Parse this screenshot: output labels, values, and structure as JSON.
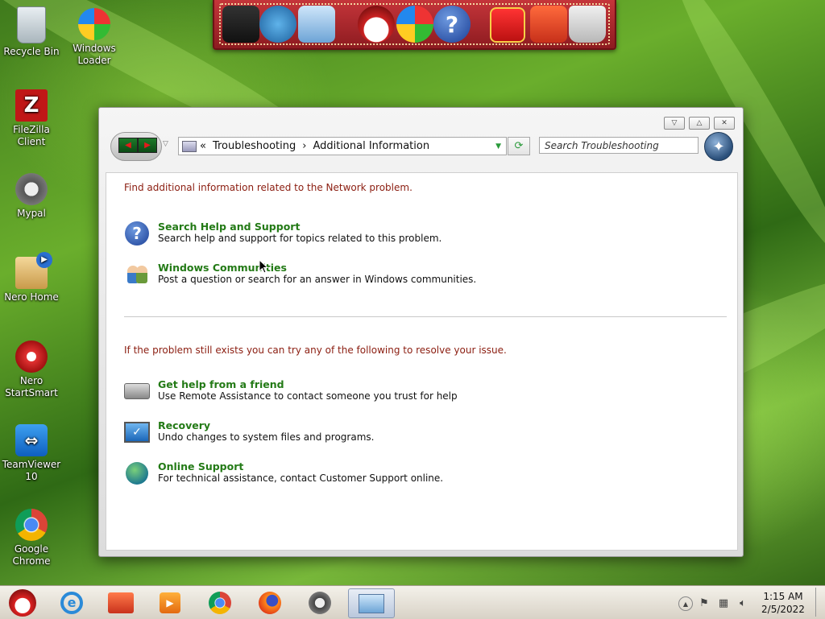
{
  "desktop_icons": [
    {
      "label": "Recycle Bin",
      "icon": "recycle-bin-icon"
    },
    {
      "label": "Windows Loader",
      "icon": "windows-loader-icon"
    },
    {
      "label": "FileZilla Client",
      "icon": "filezilla-icon"
    },
    {
      "label": "Mypal",
      "icon": "mypal-raccoon-icon"
    },
    {
      "label": "Nero Home",
      "icon": "nero-home-icon"
    },
    {
      "label": "Nero StartSmart",
      "icon": "nero-startsmart-icon"
    },
    {
      "label": "TeamViewer 10",
      "icon": "teamviewer-icon"
    },
    {
      "label": "Google Chrome",
      "icon": "chrome-icon"
    }
  ],
  "dock": {
    "items": [
      "computer-santa-icon",
      "network-globe-icon",
      "control-panel-icon",
      "snowman-icon",
      "windows-media-icon",
      "help-icon",
      "gift-icon",
      "folder-icon",
      "trash-icon"
    ]
  },
  "window": {
    "breadcrumb": {
      "overflow": "«",
      "parent": "Troubleshooting",
      "separator": "›",
      "current": "Additional Information"
    },
    "search_placeholder": "Search Troubleshooting",
    "caption": {
      "minimize": "▽",
      "maximize": "△",
      "close": "✕"
    },
    "intro": "Find additional information related to the Network problem.",
    "tasks_primary": [
      {
        "title": "Search Help and Support",
        "desc": "Search help and support for topics related to this problem.",
        "icon": "help-question-icon"
      },
      {
        "title": "Windows Communities",
        "desc": "Post a question or search for an answer in Windows communities.",
        "icon": "communities-people-icon"
      }
    ],
    "intro2": "If the problem still exists you can try any of the following to resolve your issue.",
    "tasks_secondary": [
      {
        "title": "Get help from a friend",
        "desc": "Use Remote Assistance to contact someone you trust for help",
        "icon": "remote-assistance-icon"
      },
      {
        "title": "Recovery",
        "desc": "Undo changes to system files and programs.",
        "icon": "recovery-monitor-icon"
      },
      {
        "title": "Online Support",
        "desc": "For technical assistance, contact Customer Support online.",
        "icon": "online-support-globe-icon"
      }
    ]
  },
  "taskbar": {
    "pinned": [
      "start-santa-icon",
      "internet-explorer-icon",
      "file-explorer-icon",
      "media-player-icon",
      "chrome-icon",
      "firefox-icon",
      "mypal-icon",
      "control-panel-active-icon"
    ],
    "clock": {
      "time": "1:15 AM",
      "date": "2/5/2022"
    }
  }
}
